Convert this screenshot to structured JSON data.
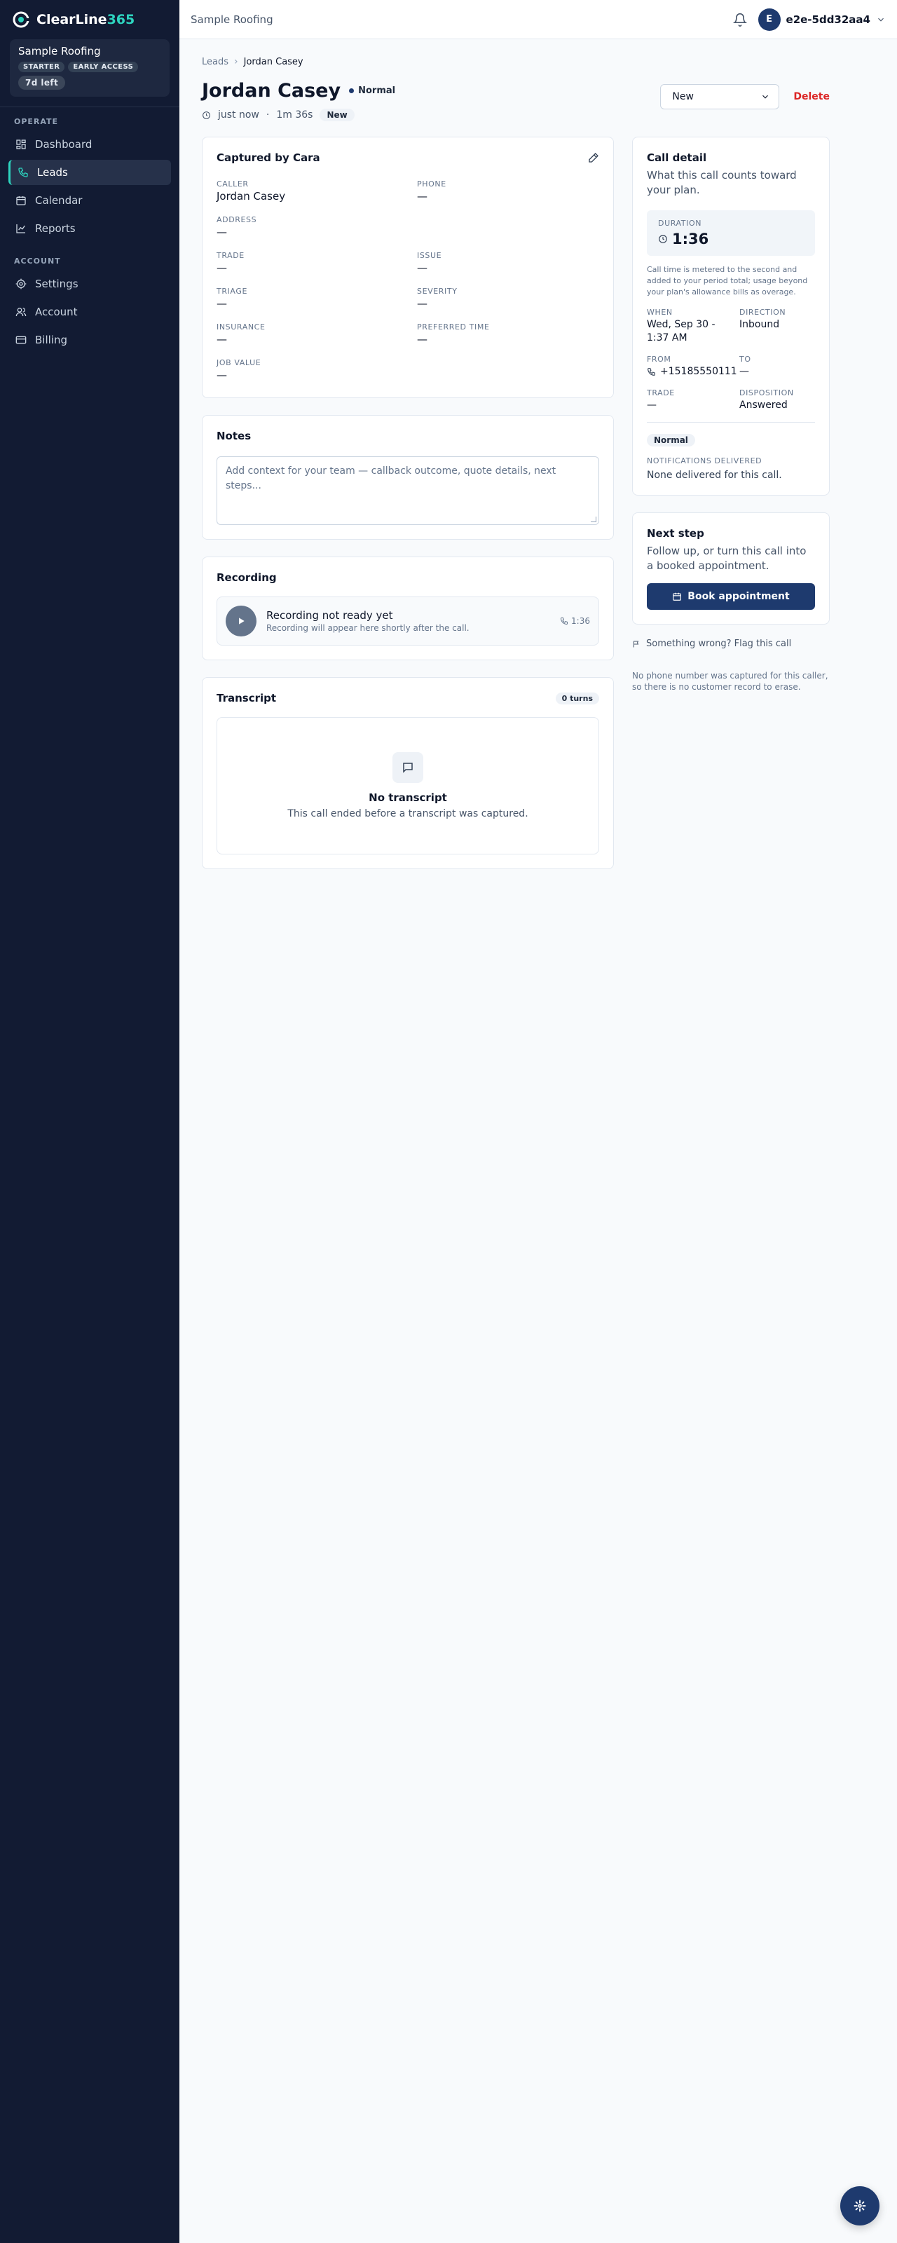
{
  "brand": {
    "name": "ClearLine",
    "accent": "365"
  },
  "org": {
    "name": "Sample Roofing",
    "badges": [
      "STARTER",
      "EARLY ACCESS"
    ],
    "trial": "7d left"
  },
  "nav": {
    "operate_label": "OPERATE",
    "account_label": "ACCOUNT",
    "items": [
      {
        "label": "Dashboard",
        "icon": "dashboard-icon"
      },
      {
        "label": "Leads",
        "icon": "phone-icon"
      },
      {
        "label": "Calendar",
        "icon": "calendar-icon"
      },
      {
        "label": "Reports",
        "icon": "chart-icon"
      },
      {
        "label": "Settings",
        "icon": "gear-icon"
      },
      {
        "label": "Account",
        "icon": "users-icon"
      },
      {
        "label": "Billing",
        "icon": "card-icon"
      }
    ]
  },
  "topbar": {
    "org": "Sample Roofing",
    "user_initial": "E",
    "user_name": "e2e-5dd32aa4"
  },
  "breadcrumb": {
    "parent": "Leads",
    "current": "Jordan Casey"
  },
  "lead": {
    "name": "Jordan Casey",
    "priority": "Normal",
    "time_ago": "just now",
    "call_length": "1m 36s",
    "status": "New",
    "status_select": "New",
    "delete_label": "Delete"
  },
  "captured": {
    "title": "Captured by Cara",
    "fields": {
      "caller_label": "CALLER",
      "caller": "Jordan Casey",
      "phone_label": "PHONE",
      "phone": "—",
      "address_label": "ADDRESS",
      "address": "—",
      "trade_label": "TRADE",
      "trade": "—",
      "issue_label": "ISSUE",
      "issue": "—",
      "triage_label": "TRIAGE",
      "triage": "—",
      "severity_label": "SEVERITY",
      "severity": "—",
      "insurance_label": "INSURANCE",
      "insurance": "—",
      "preferred_time_label": "PREFERRED TIME",
      "preferred_time": "—",
      "job_value_label": "JOB VALUE",
      "job_value": "—"
    }
  },
  "notes": {
    "title": "Notes",
    "placeholder": "Add context for your team — callback outcome, quote details, next steps..."
  },
  "recording": {
    "title": "Recording",
    "status": "Recording not ready yet",
    "sub": "Recording will appear here shortly after the call.",
    "duration": "1:36"
  },
  "transcript": {
    "title": "Transcript",
    "turns": "0 turns",
    "empty_title": "No transcript",
    "empty_sub": "This call ended before a transcript was captured."
  },
  "call_detail": {
    "title": "Call detail",
    "sub": "What this call counts toward your plan.",
    "duration_label": "DURATION",
    "duration": "1:36",
    "fine_print": "Call time is metered to the second and added to your period total; usage beyond your plan's allowance bills as overage.",
    "when_label": "WHEN",
    "when": "Wed, Sep 30 - 1:37 AM",
    "direction_label": "DIRECTION",
    "direction": "Inbound",
    "from_label": "FROM",
    "from": "+15185550111",
    "to_label": "TO",
    "to": "—",
    "trade_label": "TRADE",
    "trade": "—",
    "disposition_label": "DISPOSITION",
    "disposition": "Answered",
    "priority_chip": "Normal",
    "notif_label": "NOTIFICATIONS DELIVERED",
    "notif_value": "None delivered for this call."
  },
  "next_step": {
    "title": "Next step",
    "sub": "Follow up, or turn this call into a booked appointment.",
    "button": "Book appointment"
  },
  "flag": "Something wrong? Flag this call",
  "no_phone_note": "No phone number was captured for this caller, so there is no customer record to erase.",
  "colors": {
    "sidebar": "#121b33",
    "accent": "#2dd4bf",
    "primary": "#1e3a6e",
    "danger": "#dc2626"
  }
}
